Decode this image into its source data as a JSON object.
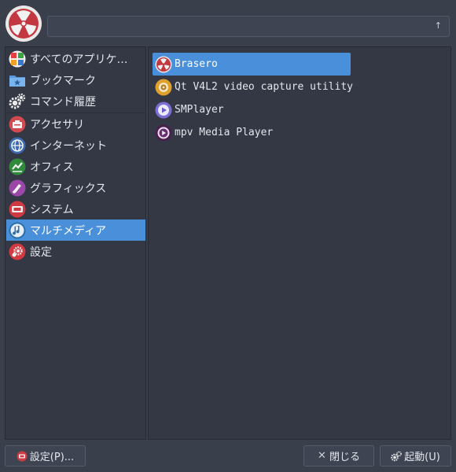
{
  "header": {
    "search": {
      "value": "",
      "placeholder": "",
      "clear_glyph": "↑",
      "clear_icon": "clear-arrow-icon"
    }
  },
  "categories": [
    {
      "label": "すべてのアプリケ…",
      "icon": "all-apps-icon",
      "selected": false
    },
    {
      "label": "ブックマーク",
      "icon": "bookmark-folder-icon",
      "selected": false
    },
    {
      "label": "コマンド履歴",
      "icon": "gear-icon",
      "selected": false
    },
    {
      "label": "アクセサリ",
      "icon": "accessories-icon",
      "selected": false
    },
    {
      "label": "インターネット",
      "icon": "internet-icon",
      "selected": false
    },
    {
      "label": "オフィス",
      "icon": "office-icon",
      "selected": false
    },
    {
      "label": "グラフィックス",
      "icon": "graphics-icon",
      "selected": false
    },
    {
      "label": "システム",
      "icon": "system-icon",
      "selected": false
    },
    {
      "label": "マルチメディア",
      "icon": "multimedia-icon",
      "selected": true
    },
    {
      "label": "設定",
      "icon": "settings-icon",
      "selected": false
    }
  ],
  "apps": [
    {
      "label": "Brasero",
      "icon": "brasero-icon",
      "selected": true
    },
    {
      "label": "Qt V4L2 video capture utility",
      "icon": "webcam-icon",
      "selected": false
    },
    {
      "label": "SMPlayer",
      "icon": "smplayer-icon",
      "selected": false
    },
    {
      "label": "mpv Media Player",
      "icon": "mpv-icon",
      "selected": false
    }
  ],
  "footer": {
    "settings_label": "設定(P)...",
    "close_label": "閉じる",
    "close_glyph": "✕",
    "launch_label": "起動(U)"
  },
  "colors": {
    "background": "#3a3f4c",
    "panel": "#333844",
    "selection": "#4a8fd9",
    "accent_red": "#c9343d"
  }
}
